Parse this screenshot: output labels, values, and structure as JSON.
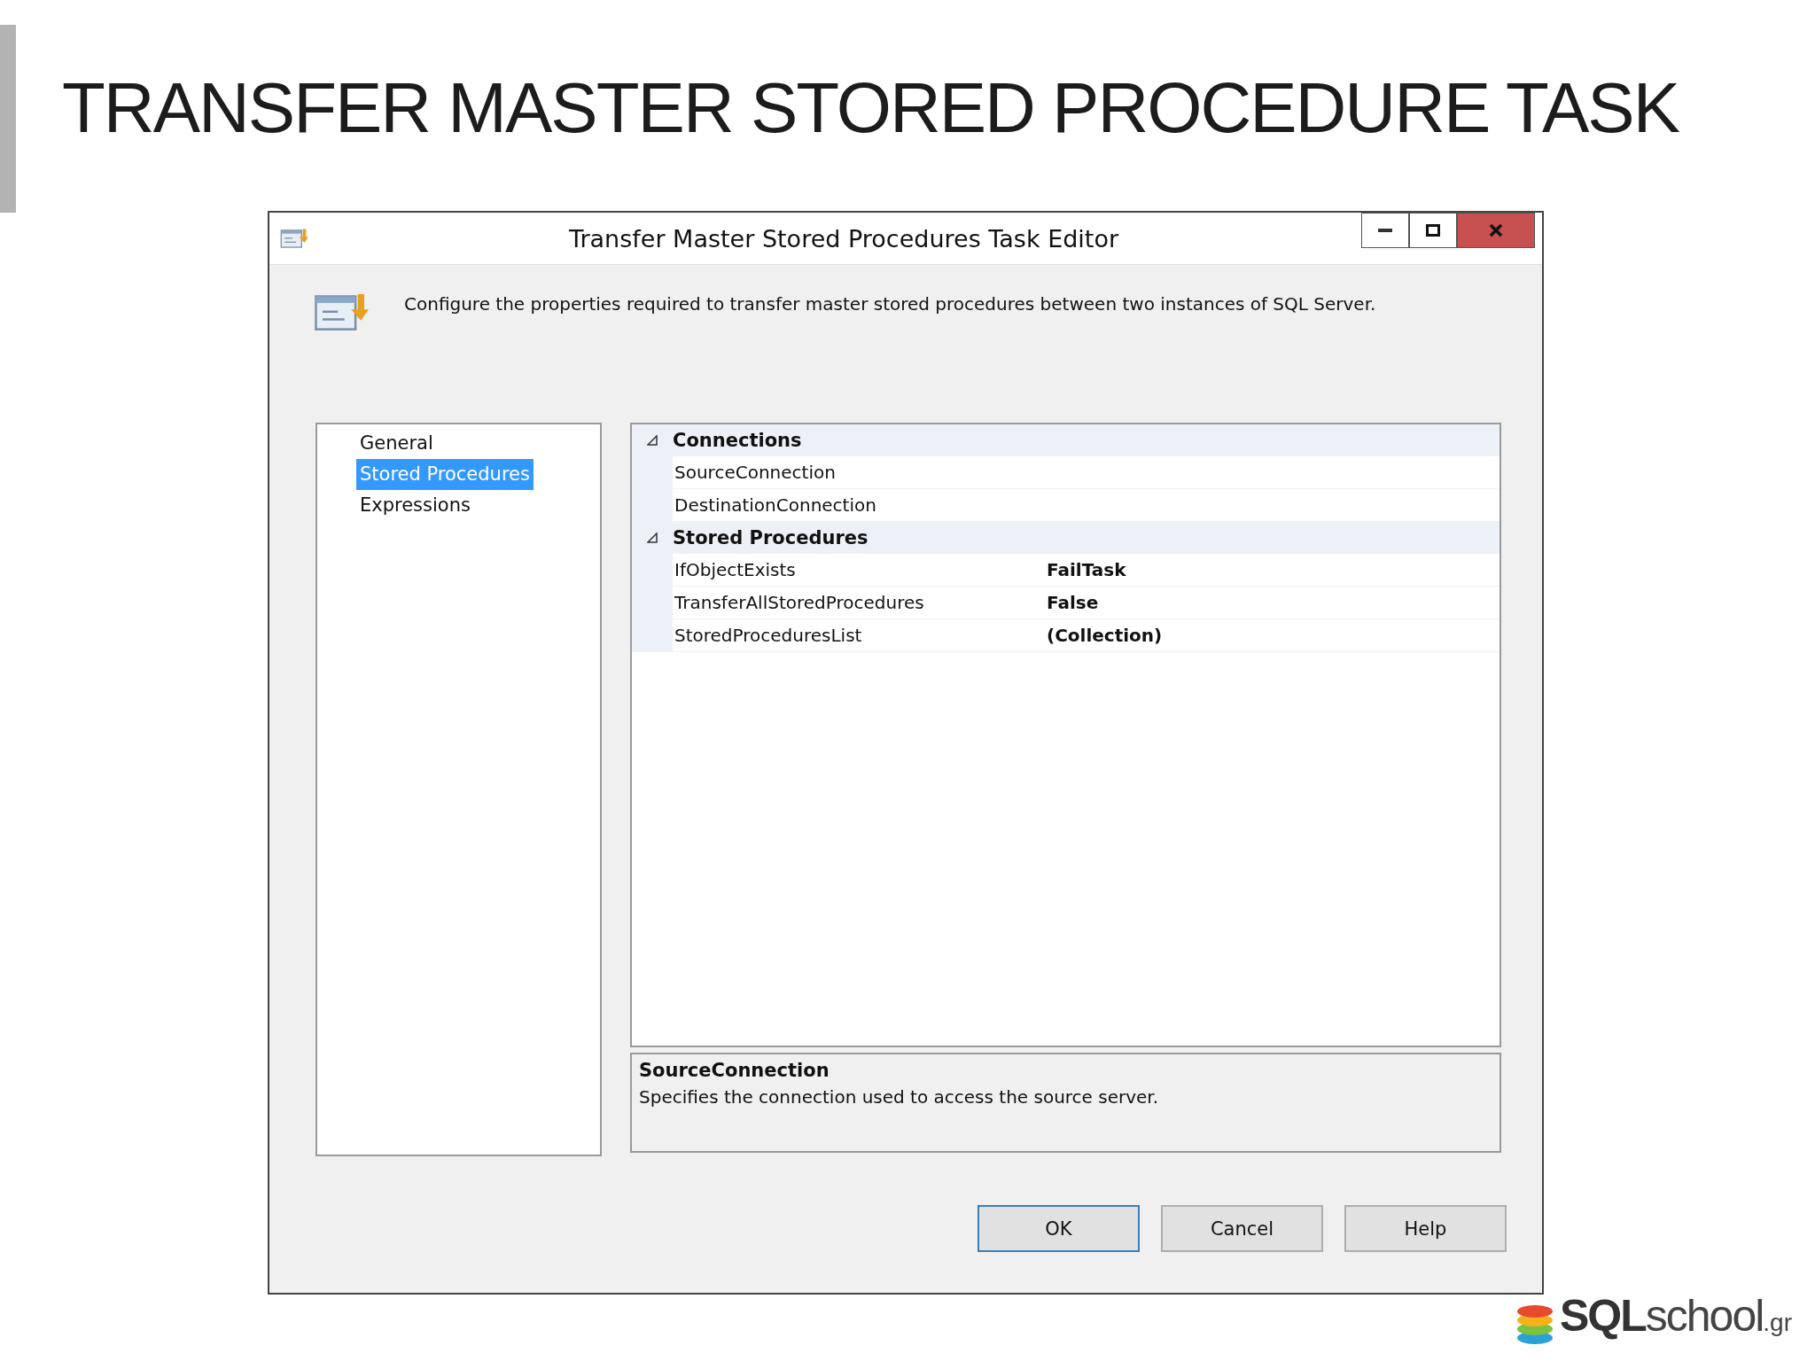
{
  "slide_title": "TRANSFER MASTER STORED PROCEDURE TASK",
  "dialog": {
    "title": "Transfer Master Stored Procedures Task Editor",
    "description": "Configure the properties required to transfer master stored procedures between two instances of SQL Server.",
    "nav": [
      {
        "label": "General",
        "selected": false
      },
      {
        "label": "Stored Procedures",
        "selected": true
      },
      {
        "label": "Expressions",
        "selected": false
      }
    ],
    "property_grid": {
      "categories": [
        {
          "name": "Connections",
          "expanded": true,
          "properties": [
            {
              "name": "SourceConnection"
            },
            {
              "name": "DestinationConnection"
            }
          ]
        },
        {
          "name": "Stored Procedures",
          "expanded": true,
          "properties": [
            {
              "name": "IfObjectExists",
              "value": "FailTask"
            },
            {
              "name": "TransferAllStoredProcedures",
              "value": "False"
            },
            {
              "name": "StoredProceduresList",
              "value": "(Collection)"
            }
          ]
        }
      ]
    },
    "help_panel": {
      "title": "SourceConnection",
      "text": "Specifies the connection used to access the source server."
    },
    "buttons": [
      {
        "label": "OK",
        "default": true
      },
      {
        "label": "Cancel",
        "default": false
      },
      {
        "label": "Help",
        "default": false
      }
    ]
  },
  "logo": {
    "bold": "SQL",
    "light": "school",
    "suffix": ".gr"
  }
}
